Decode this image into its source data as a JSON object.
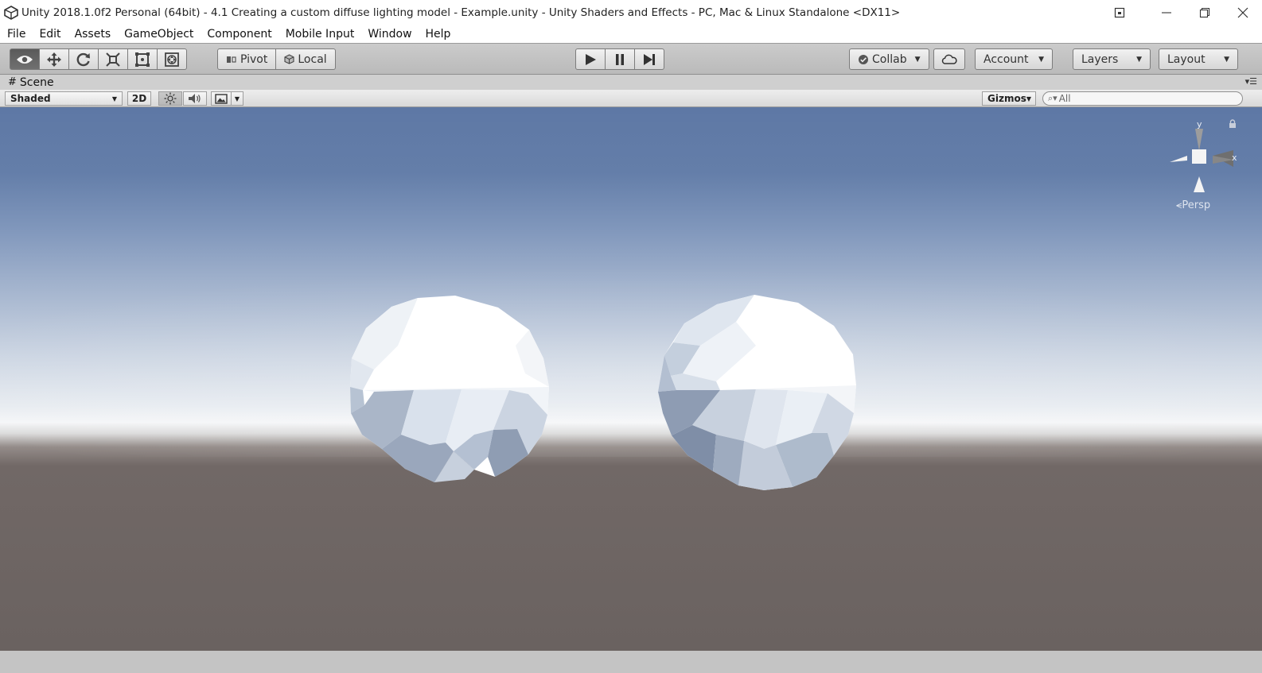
{
  "window": {
    "title": "Unity 2018.1.0f2 Personal (64bit) - 4.1 Creating a custom diffuse lighting model - Example.unity - Unity Shaders and Effects - PC, Mac & Linux Standalone <DX11>"
  },
  "menu": [
    "File",
    "Edit",
    "Assets",
    "GameObject",
    "Component",
    "Mobile Input",
    "Window",
    "Help"
  ],
  "toolbar": {
    "tools": [
      {
        "name": "view-tool",
        "icon": "eye-icon",
        "active": true
      },
      {
        "name": "move-tool",
        "icon": "move-arrows-icon",
        "active": false
      },
      {
        "name": "rotate-tool",
        "icon": "rotate-icon",
        "active": false
      },
      {
        "name": "scale-tool",
        "icon": "scale-icon",
        "active": false
      },
      {
        "name": "rect-tool",
        "icon": "rect-icon",
        "active": false
      },
      {
        "name": "transform-tool",
        "icon": "transform-icon",
        "active": false
      }
    ],
    "pivot_label": "Pivot",
    "local_label": "Local",
    "collab_label": "Collab",
    "account_label": "Account",
    "layers_label": "Layers",
    "layout_label": "Layout"
  },
  "scene": {
    "tab_label": "Scene",
    "shading_mode": "Shaded",
    "mode_2d_label": "2D",
    "gizmos_label": "Gizmos",
    "search_placeholder": "All",
    "persp_label": "Persp",
    "axis_labels": {
      "y": "y",
      "x": "x"
    }
  },
  "colors": {
    "sky_top": "#5f79a6",
    "horizon": "#f2f4f7",
    "ground": "#6c6361",
    "toolbar_active": "#5a5a5a"
  }
}
